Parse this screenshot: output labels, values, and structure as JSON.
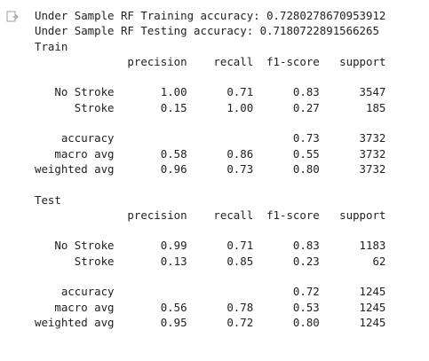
{
  "output_icon": "output-arrow-icon",
  "lines": [
    "Under Sample RF Training accuracy: 0.7280278670953912",
    "Under Sample RF Testing accuracy: 0.7180722891566265",
    "Train",
    "              precision    recall  f1-score   support",
    "",
    "   No Stroke       1.00      0.71      0.83      3547",
    "      Stroke       0.15      1.00      0.27       185",
    "",
    "    accuracy                           0.73      3732",
    "   macro avg       0.58      0.86      0.55      3732",
    "weighted avg       0.96      0.73      0.80      3732",
    "",
    "Test",
    "              precision    recall  f1-score   support",
    "",
    "   No Stroke       0.99      0.71      0.83      1183",
    "      Stroke       0.13      0.85      0.23        62",
    "",
    "    accuracy                           0.72      1245",
    "   macro avg       0.56      0.78      0.53      1245",
    "weighted avg       0.95      0.72      0.80      1245"
  ]
}
